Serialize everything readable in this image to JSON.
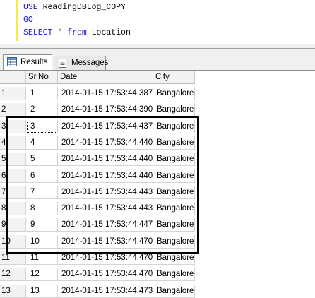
{
  "editor": {
    "lines": [
      {
        "kw": "USE",
        "rest": " ReadingDBLog_COPY",
        "op": ""
      },
      {
        "kw": "GO",
        "rest": "",
        "op": ""
      },
      {
        "kw": "SELECT",
        "op": " * ",
        "kw2": "from",
        "rest": " Location"
      }
    ]
  },
  "tabs": [
    {
      "label": "Results",
      "icon": "results-grid-icon",
      "active": true
    },
    {
      "label": "Messages",
      "icon": "messages-icon",
      "active": false
    }
  ],
  "grid": {
    "columns": [
      "",
      "Sr.No",
      "Date",
      "City"
    ],
    "rows": [
      [
        "1",
        "1",
        "2014-01-15 17:53:44.387",
        "Bangalore"
      ],
      [
        "2",
        "2",
        "2014-01-15 17:53:44.390",
        "Bangalore"
      ],
      [
        "3",
        "3",
        "2014-01-15 17:53:44.437",
        "Bangalore"
      ],
      [
        "4",
        "4",
        "2014-01-15 17:53:44.440",
        "Bangalore"
      ],
      [
        "5",
        "5",
        "2014-01-15 17:53:44.440",
        "Bangalore"
      ],
      [
        "6",
        "6",
        "2014-01-15 17:53:44.440",
        "Bangalore"
      ],
      [
        "7",
        "7",
        "2014-01-15 17:53:44.443",
        "Bangalore"
      ],
      [
        "8",
        "8",
        "2014-01-15 17:53:44.443",
        "Bangalore"
      ],
      [
        "9",
        "9",
        "2014-01-15 17:53:44.447",
        "Bangalore"
      ],
      [
        "10",
        "10",
        "2014-01-15 17:53:44.470",
        "Bangalore"
      ],
      [
        "11",
        "11",
        "2014-01-15 17:53:44.470",
        "Bangalore"
      ],
      [
        "12",
        "12",
        "2014-01-15 17:53:44.470",
        "Bangalore"
      ],
      [
        "13",
        "13",
        "2014-01-15 17:53:44.473",
        "Bangalore"
      ]
    ],
    "selected_row": 3
  },
  "colors": {
    "keyword": "#1a18d6",
    "operator": "#808080",
    "gutter": "#f7e94a",
    "highlight_box": "#000000"
  }
}
